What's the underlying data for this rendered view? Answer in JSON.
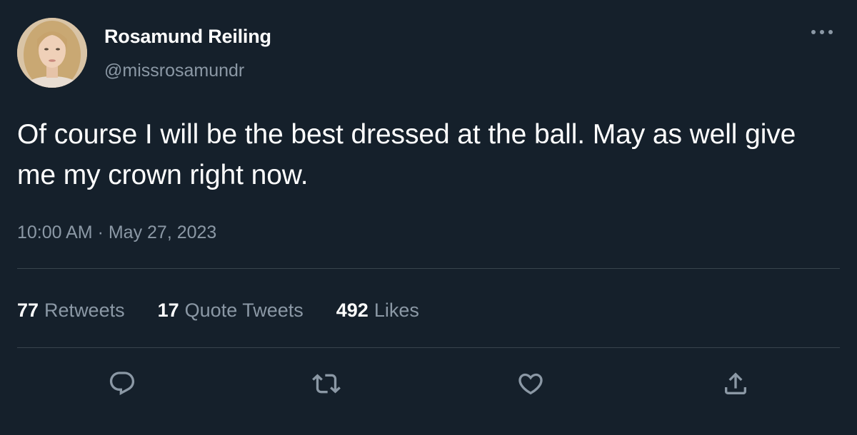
{
  "tweet": {
    "author": {
      "display_name": "Rosamund Reiling",
      "handle": "@missrosamundr",
      "avatar": "profile-photo"
    },
    "text": "Of course I will be the best dressed at the ball. May as well give me my crown right now.",
    "timestamp": "10:00 AM · May 27, 2023",
    "stats": {
      "retweets": {
        "count": "77",
        "label": "Retweets"
      },
      "quote_tweets": {
        "count": "17",
        "label": "Quote Tweets"
      },
      "likes": {
        "count": "492",
        "label": "Likes"
      }
    },
    "actions": [
      {
        "name": "reply",
        "icon": "reply-icon"
      },
      {
        "name": "retweet",
        "icon": "retweet-icon"
      },
      {
        "name": "like",
        "icon": "heart-icon"
      },
      {
        "name": "share",
        "icon": "share-icon"
      }
    ],
    "more_icon": "more-icon"
  },
  "colors": {
    "background": "#15202b",
    "primary_text": "#ffffff",
    "secondary_text": "#8b98a5",
    "divider": "#38444d"
  }
}
